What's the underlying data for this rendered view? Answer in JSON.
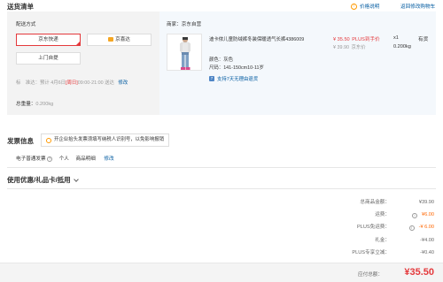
{
  "header": {
    "title": "送货清单",
    "price_help": "价格说明",
    "back_cart": "返回修改购物车"
  },
  "delivery": {
    "section_label": "配送方式",
    "options": [
      "京东快递",
      "京喜达"
    ],
    "pickup_option": "上门自提",
    "schedule_prefix": "标　准达：预计 4月6日",
    "schedule_day": "[周日]",
    "schedule_time": "09:00-21:00 送达",
    "schedule_modify": "修改",
    "weight_label": "总重量：",
    "weight_value": "0.200kg"
  },
  "shop": {
    "seller_label": "商家：",
    "seller_name": "京东自营"
  },
  "product": {
    "name": "迪卡侬儿童防绒裤冬装保暖透气长裤4386009",
    "price": "¥ 35.50",
    "price_tag": "PLUS到手价",
    "orig_price": "¥ 39.90",
    "orig_tag": "京东价",
    "qty": "x1",
    "stock": "有货",
    "weight": "0.200kg",
    "color_label": "颜色：",
    "color_value": "灰色",
    "size_label": "尺码：",
    "size_value": "141-150cm10-11岁",
    "return_policy": "支持7天无理由退货"
  },
  "invoice": {
    "title": "发票信息",
    "tip": "开企业抬头发票须填写纳税人识别号，以免影响报销",
    "type": "电子普通发票",
    "holder": "个人",
    "content": "商品明细",
    "modify": "修改"
  },
  "coupons": {
    "title": "使用优惠/礼品卡/抵用"
  },
  "summary": {
    "rows": [
      {
        "label": "总商品金额：",
        "value": "¥39.90"
      },
      {
        "label": "运费：",
        "value": "¥6.00"
      },
      {
        "label": "PLUS免运费：",
        "value": "-¥ 6.00"
      },
      {
        "label": "礼金：",
        "value": "-¥4.00"
      },
      {
        "label": "PLUS专享立减：",
        "value": "-¥0.40"
      }
    ],
    "total_label": "应付总额：",
    "total_value": "¥35.50"
  },
  "colors": {
    "accent_red": "#e4393c",
    "link_blue": "#005aa0",
    "orange": "#ff6600",
    "panel_bg": "#f3f3f3",
    "product_bg": "#f4f8fc"
  }
}
